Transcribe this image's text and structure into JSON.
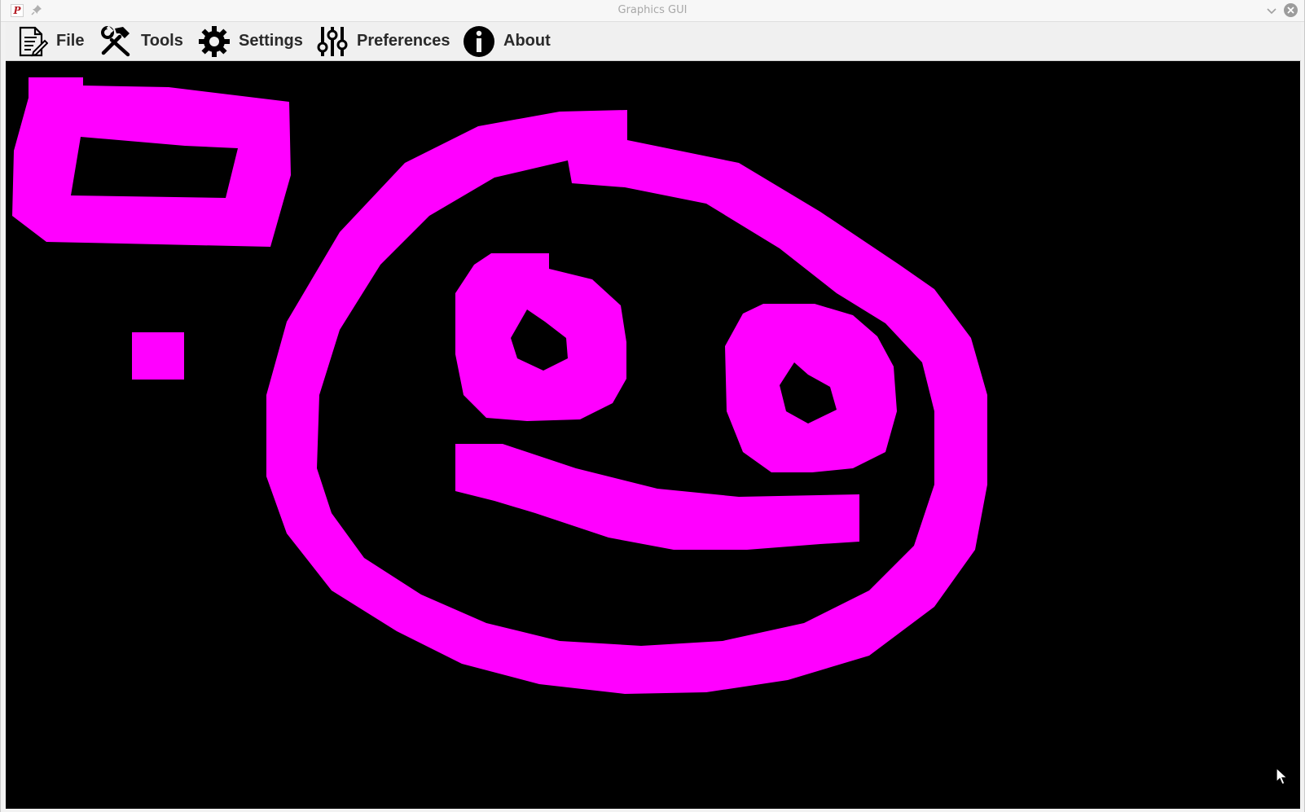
{
  "window": {
    "title": "Graphics GUI",
    "app_icon_letter": "P"
  },
  "menu": {
    "items": [
      {
        "label": "File",
        "icon": "document-icon"
      },
      {
        "label": "Tools",
        "icon": "hammer-wrench-icon"
      },
      {
        "label": "Settings",
        "icon": "gear-icon"
      },
      {
        "label": "Preferences",
        "icon": "sliders-icon"
      },
      {
        "label": "About",
        "icon": "info-icon"
      }
    ]
  },
  "canvas": {
    "background": "#000000",
    "stroke_color": "#ff00ff",
    "drawing": [
      "rectangle",
      "square",
      "face-circle",
      "left-eye",
      "right-eye",
      "mouth"
    ]
  }
}
